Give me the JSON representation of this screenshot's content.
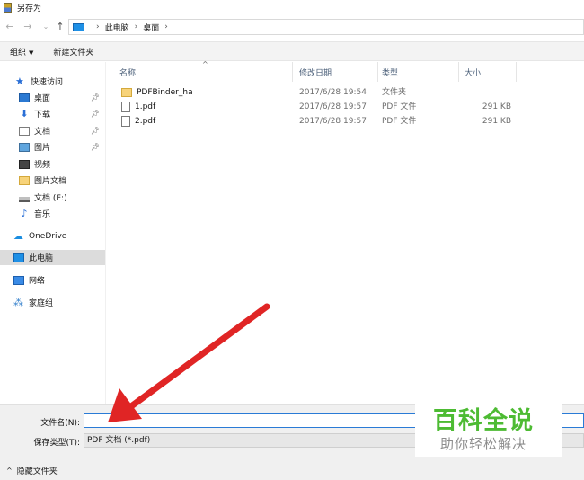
{
  "window": {
    "title": "另存为"
  },
  "address": {
    "crumbs": [
      "此电脑",
      "桌面"
    ]
  },
  "toolbar": {
    "organize": "组织",
    "new_folder": "新建文件夹"
  },
  "sidebar": {
    "items": [
      {
        "label": "快速访问",
        "icon": "star-icon",
        "pinned": false
      },
      {
        "label": "桌面",
        "icon": "desktop-icon",
        "pinned": true
      },
      {
        "label": "下载",
        "icon": "download-icon",
        "pinned": true
      },
      {
        "label": "文档",
        "icon": "document-icon",
        "pinned": true
      },
      {
        "label": "图片",
        "icon": "picture-icon",
        "pinned": true
      },
      {
        "label": "视频",
        "icon": "video-icon",
        "pinned": false
      },
      {
        "label": "图片文档",
        "icon": "folder-icon",
        "pinned": false
      },
      {
        "label": "文档 (E:)",
        "icon": "drive-icon",
        "pinned": false
      },
      {
        "label": "音乐",
        "icon": "music-icon",
        "pinned": false
      },
      {
        "label": "OneDrive",
        "icon": "cloud-icon",
        "pinned": false
      },
      {
        "label": "此电脑",
        "icon": "computer-icon",
        "pinned": false,
        "selected": true
      },
      {
        "label": "网络",
        "icon": "network-icon",
        "pinned": false
      },
      {
        "label": "家庭组",
        "icon": "homegroup-icon",
        "pinned": false
      }
    ]
  },
  "columns": {
    "name": "名称",
    "date": "修改日期",
    "type": "类型",
    "size": "大小"
  },
  "files": [
    {
      "name": "PDFBinder_ha",
      "date": "2017/6/28 19:54",
      "type": "文件夹",
      "size": "",
      "icon": "folder-icon"
    },
    {
      "name": "1.pdf",
      "date": "2017/6/28 19:57",
      "type": "PDF 文件",
      "size": "291 KB",
      "icon": "pdf-file-icon"
    },
    {
      "name": "2.pdf",
      "date": "2017/6/28 19:57",
      "type": "PDF 文件",
      "size": "291 KB",
      "icon": "pdf-file-icon"
    }
  ],
  "save": {
    "filename_label": "文件名(N):",
    "filename_value": "",
    "filetype_label": "保存类型(T):",
    "filetype_value": "PDF 文档 (*.pdf)"
  },
  "footer": {
    "hide_folders": "隐藏文件夹"
  },
  "watermark": {
    "main": "百科全说",
    "sub": "助你轻松解决"
  },
  "colors": {
    "accent": "#2a7bd6",
    "arrow": "#e02525",
    "watermark_green": "#4dbb33"
  }
}
